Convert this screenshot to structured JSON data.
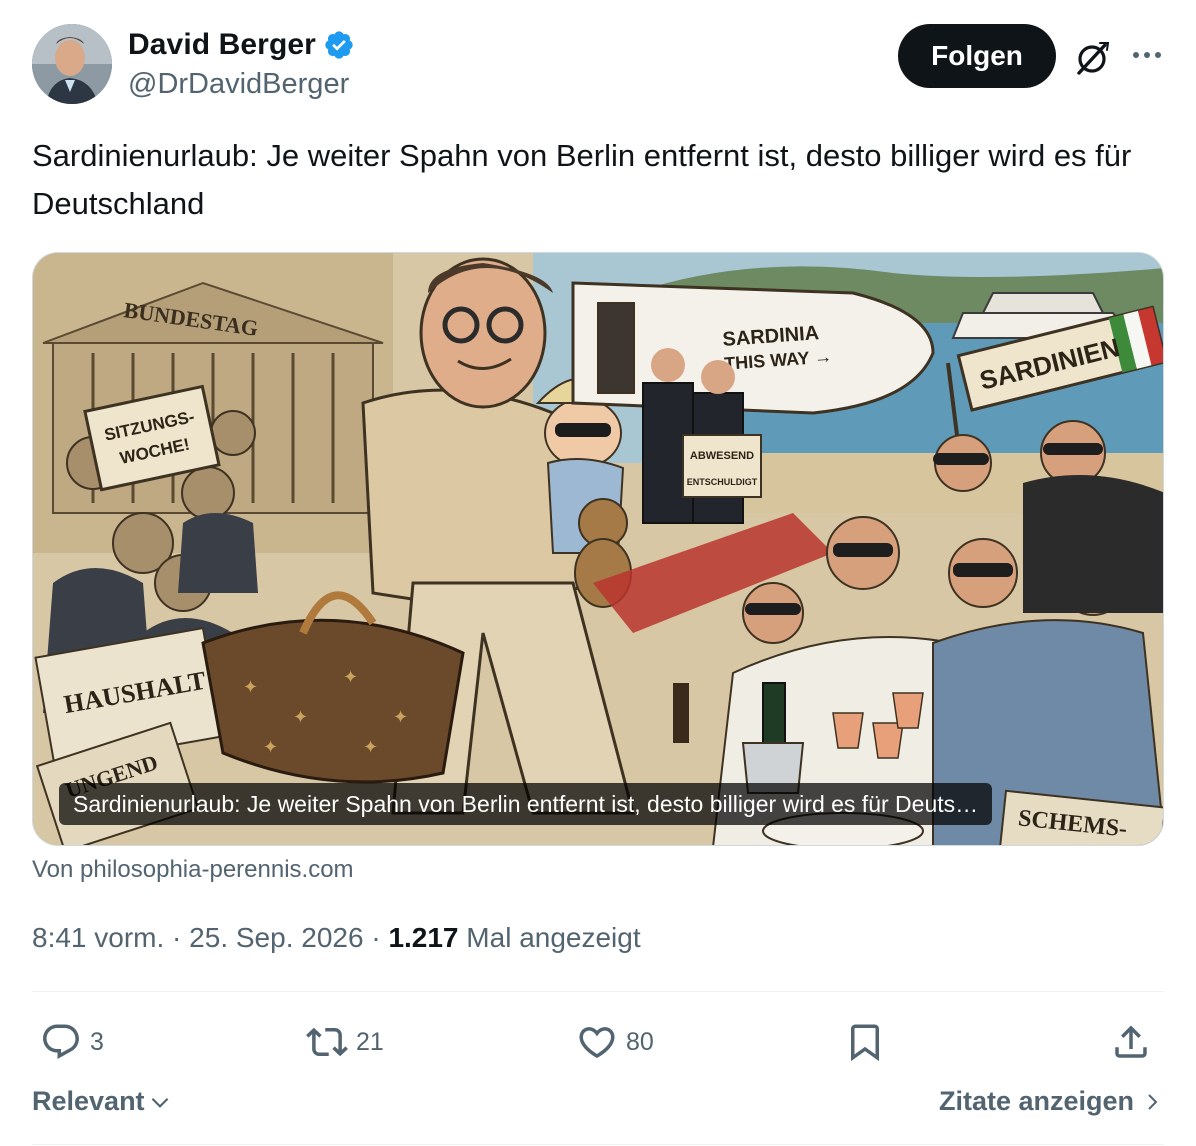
{
  "author": {
    "display_name": "David Berger",
    "handle": "@DrDavidBerger",
    "verified": true,
    "verified_color": "#1d9bf0"
  },
  "header": {
    "follow_label": "Folgen",
    "grok_icon": "grok-icon",
    "more_icon": "more-icon"
  },
  "tweet": {
    "text": "Sardinienurlaub: Je weiter Spahn von Berlin entfernt ist, desto billiger wird es für Deutschland"
  },
  "card": {
    "caption": "Sardinienurlaub: Je weiter Spahn von Berlin entfernt ist, desto billiger wird es für Deuts…",
    "source": "Von philosophia-perennis.com",
    "illustration_labels": {
      "bundestag": "BUNDESTAG",
      "sitzungswoche_1": "SITZUNGS-",
      "sitzungswoche_2": "WOCHE!",
      "haushalt": "HAUSHALT",
      "ungend": "UNGEND",
      "sardinia_1": "SARDINIA",
      "sardinia_2": "THIS WAY →",
      "abwesend": "ABWESEND",
      "entschuldigt": "ENTSCHULDIGT",
      "sardinien": "SARDINIEN",
      "schems": "SCHEMS-"
    }
  },
  "meta": {
    "time": "8:41 vorm.",
    "sep1": " · ",
    "date": "25. Sep. 2026",
    "sep2": " · ",
    "views": "1.217",
    "views_label": " Mal angezeigt"
  },
  "actions": {
    "replies": "3",
    "retweets": "21",
    "likes": "80"
  },
  "footer": {
    "sort_label": "Relevant",
    "quotes_label": "Zitate anzeigen"
  },
  "colors": {
    "text_primary": "#0f1419",
    "text_secondary": "#536471",
    "divider": "#eff3f4"
  }
}
